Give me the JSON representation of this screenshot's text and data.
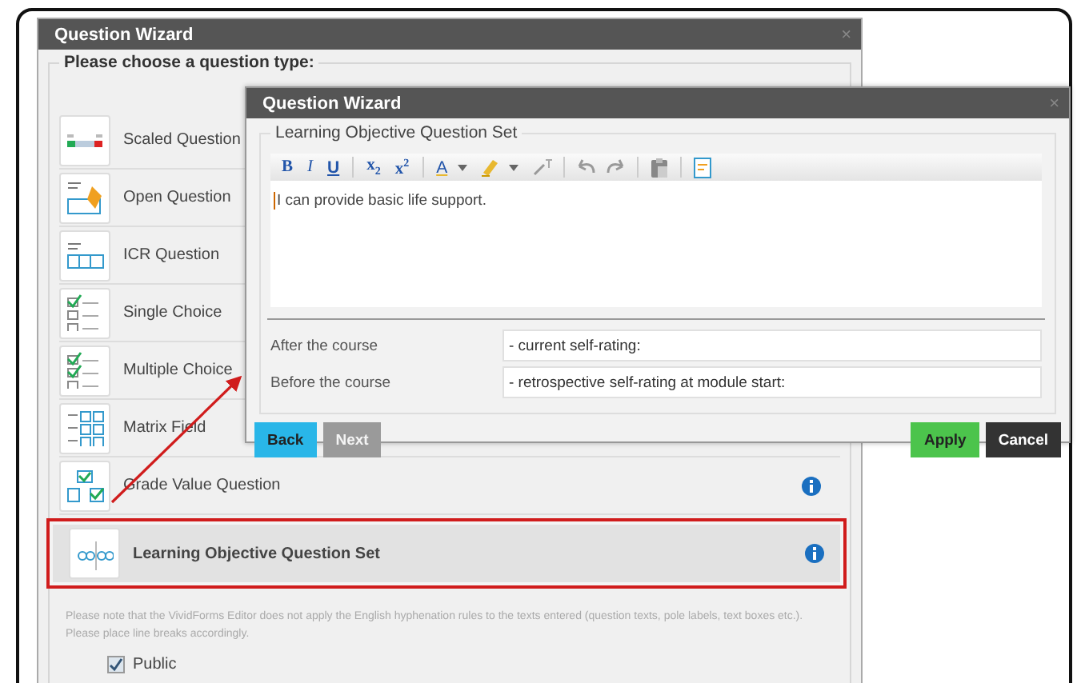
{
  "back_window": {
    "title": "Question Wizard",
    "close": "×",
    "legend": "Please choose a question type:",
    "question_types": [
      {
        "label": "Scaled Question",
        "kind": "scaled",
        "info": false,
        "selected": false
      },
      {
        "label": "Open Question",
        "kind": "open",
        "info": false,
        "selected": false
      },
      {
        "label": "ICR Question",
        "kind": "icr",
        "info": false,
        "selected": false
      },
      {
        "label": "Single Choice",
        "kind": "single",
        "info": false,
        "selected": false
      },
      {
        "label": "Multiple Choice",
        "kind": "multiple",
        "info": false,
        "selected": false
      },
      {
        "label": "Matrix Field",
        "kind": "matrix",
        "info": false,
        "selected": false
      },
      {
        "label": "Grade Value Question",
        "kind": "grade",
        "info": true,
        "selected": false
      },
      {
        "label": "Learning Objective Question Set",
        "kind": "objective",
        "info": true,
        "selected": true
      }
    ],
    "note": "Please note that the VividForms Editor does not apply the English hyphenation rules to the texts entered (question texts, pole labels, text boxes etc.). Please place line breaks accordingly.",
    "public": {
      "label": "Public",
      "checked": true
    }
  },
  "front_window": {
    "title": "Question Wizard",
    "close": "×",
    "legend": "Learning Objective Question Set",
    "toolbar": [
      [
        {
          "kind": "bold",
          "label": "B"
        },
        {
          "kind": "italic",
          "label": "I"
        },
        {
          "kind": "underline",
          "label": "U"
        }
      ],
      [
        {
          "kind": "subscript",
          "label": "x$_{2}$"
        },
        {
          "kind": "superscript",
          "label": "x$^{2}$"
        }
      ],
      [
        {
          "kind": "color",
          "label": "A",
          "dropdown": true
        },
        {
          "kind": "highlight",
          "dropdown": true
        },
        {
          "kind": "clear"
        }
      ],
      [
        {
          "kind": "undo"
        },
        {
          "kind": "redo"
        }
      ],
      [
        {
          "kind": "paste"
        }
      ],
      [
        {
          "kind": "source"
        }
      ]
    ],
    "editor_text": "I can provide basic life support.",
    "fields": [
      {
        "label": "After the course",
        "value": "- current self-rating:"
      },
      {
        "label": "Before the course",
        "value": "- retrospective self-rating at module start:"
      }
    ],
    "buttons": [
      {
        "label": "Back",
        "kind": "back",
        "disabled": false
      },
      {
        "label": "Next",
        "kind": "next",
        "disabled": true
      },
      {
        "label": "Apply",
        "kind": "apply",
        "disabled": false
      },
      {
        "label": "Cancel",
        "kind": "cancel",
        "disabled": false
      }
    ]
  }
}
